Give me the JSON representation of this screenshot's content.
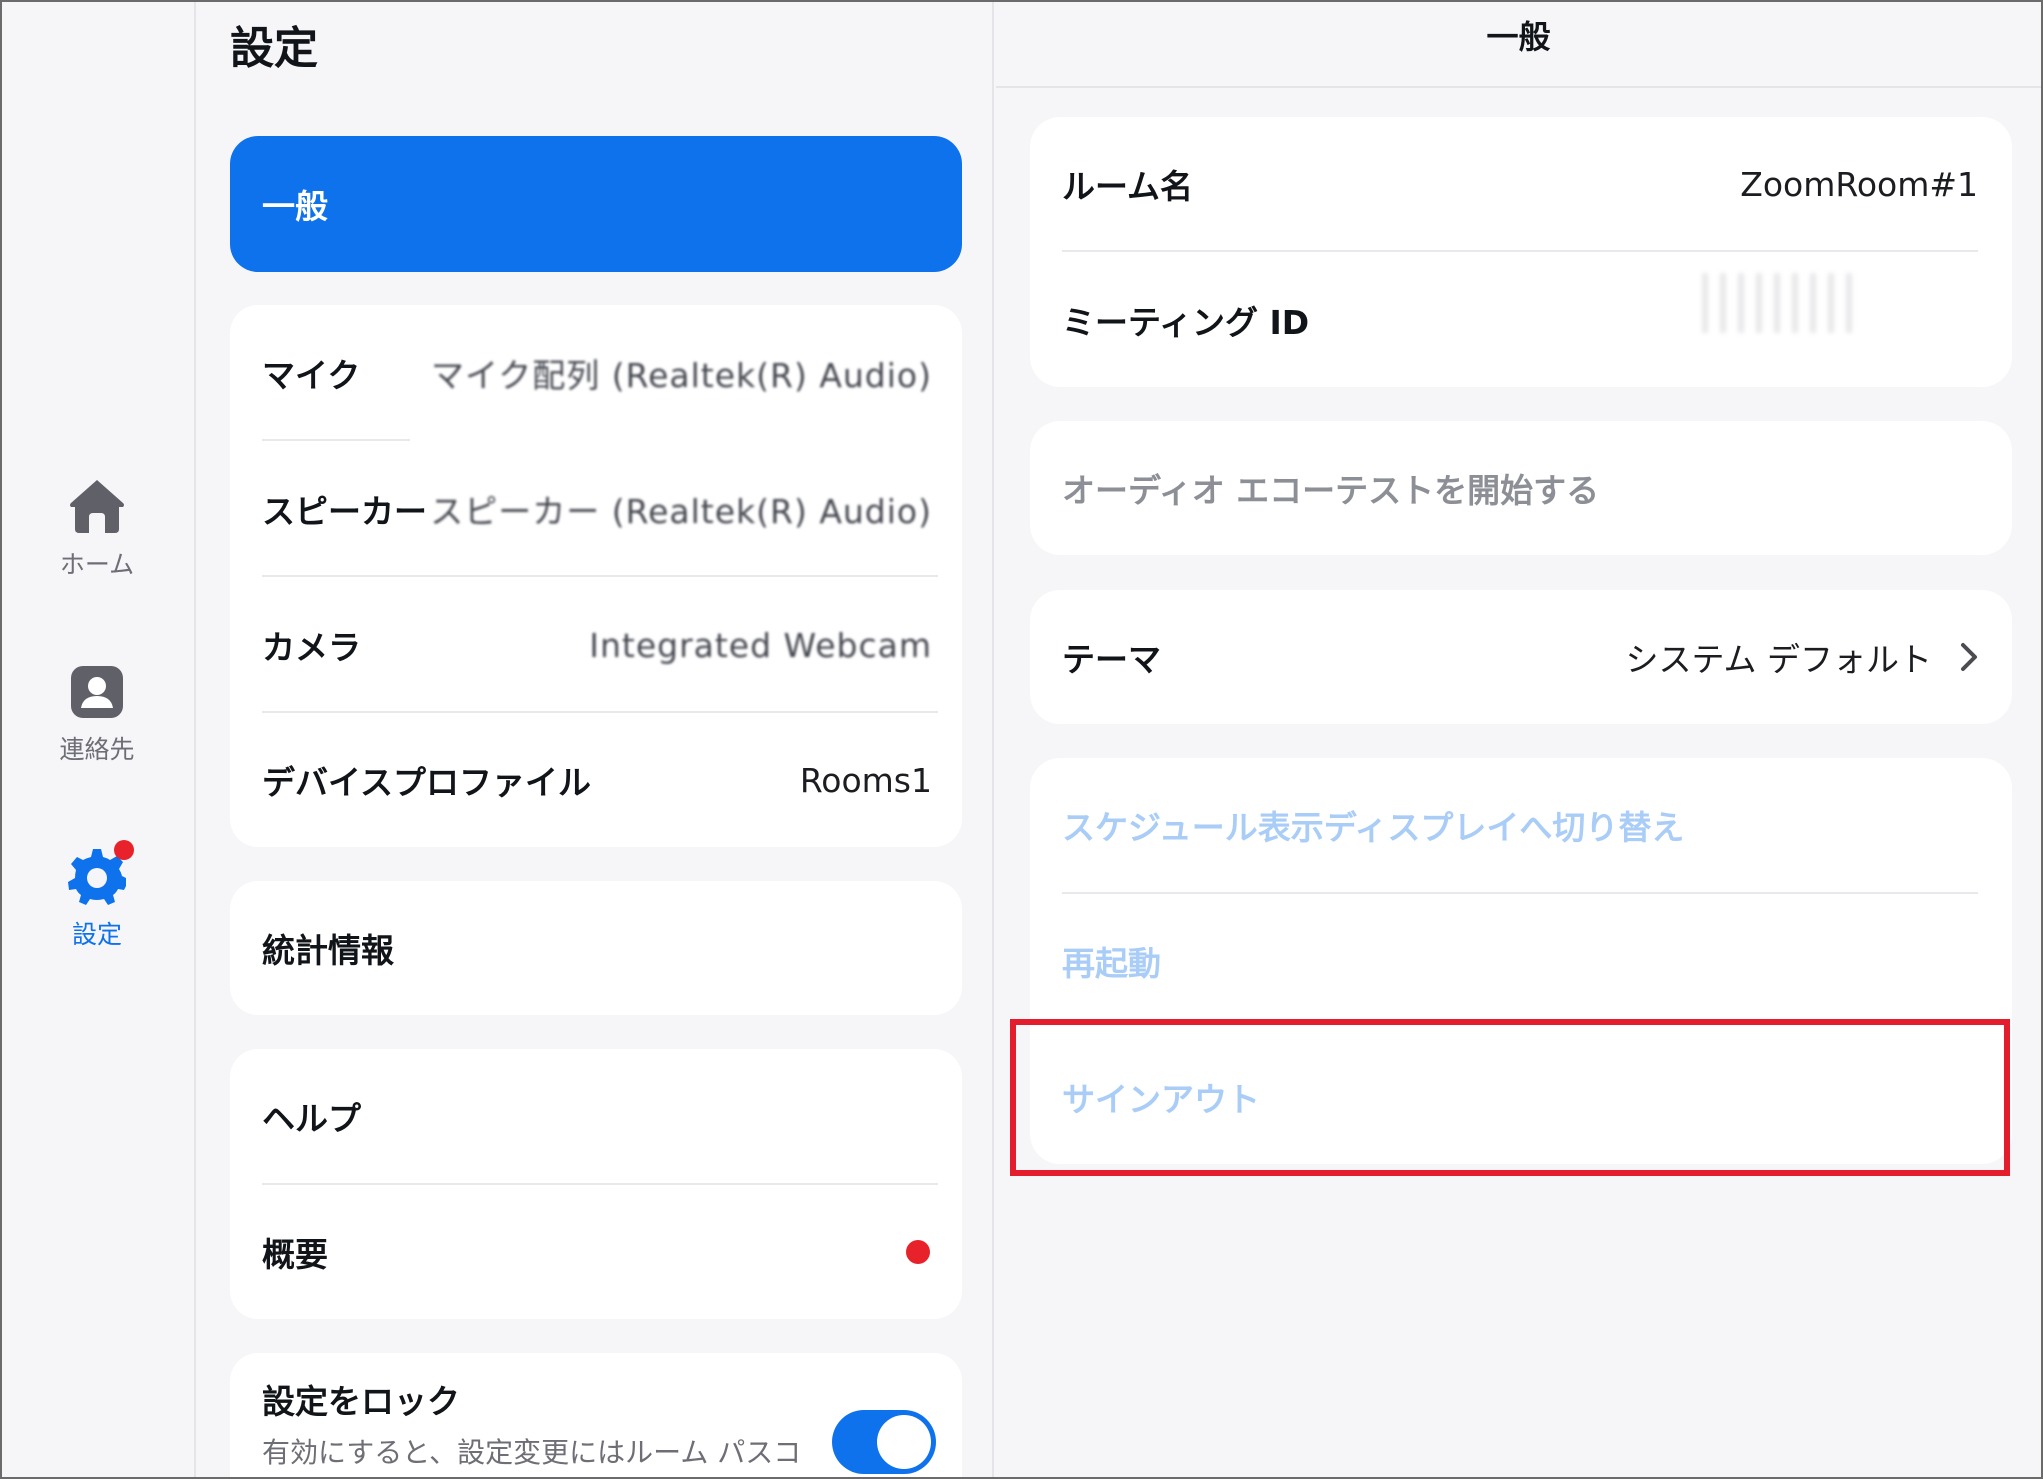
{
  "rail": {
    "home_label": "ホーム",
    "contacts_label": "連絡先",
    "settings_label": "設定"
  },
  "settings": {
    "title": "設定",
    "general_label": "一般",
    "devices": {
      "mic_label": "マイク",
      "mic_value": "マイク配列 (Realtek(R) Audio)",
      "speaker_label": "スピーカー",
      "speaker_value": "スピーカー (Realtek(R) Audio)",
      "camera_label": "カメラ",
      "camera_value": "Integrated Webcam",
      "profile_label": "デバイスプロファイル",
      "profile_value": "Rooms1"
    },
    "stats_label": "統計情報",
    "help_label": "ヘルプ",
    "about_label": "概要",
    "lock": {
      "title": "設定をロック",
      "description": "有効にすると、設定変更にはルーム パスコードが必要になります",
      "enabled": true
    }
  },
  "general": {
    "header": "一般",
    "room_name_label": "ルーム名",
    "room_name_value": "ZoomRoom#1",
    "meeting_id_label": "ミーティング ID",
    "echo_test_label": "オーディオ エコーテストを開始する",
    "theme_label": "テーマ",
    "theme_value": "システム デフォルト",
    "schedule_display_label": "スケジュール表示ディスプレイへ切り替え",
    "restart_label": "再起動",
    "signout_label": "サインアウト"
  },
  "colors": {
    "accent": "#0e72ed",
    "badge": "#e8222b",
    "highlight": "#e31d2c",
    "link_disabled": "#a9cdf7"
  }
}
